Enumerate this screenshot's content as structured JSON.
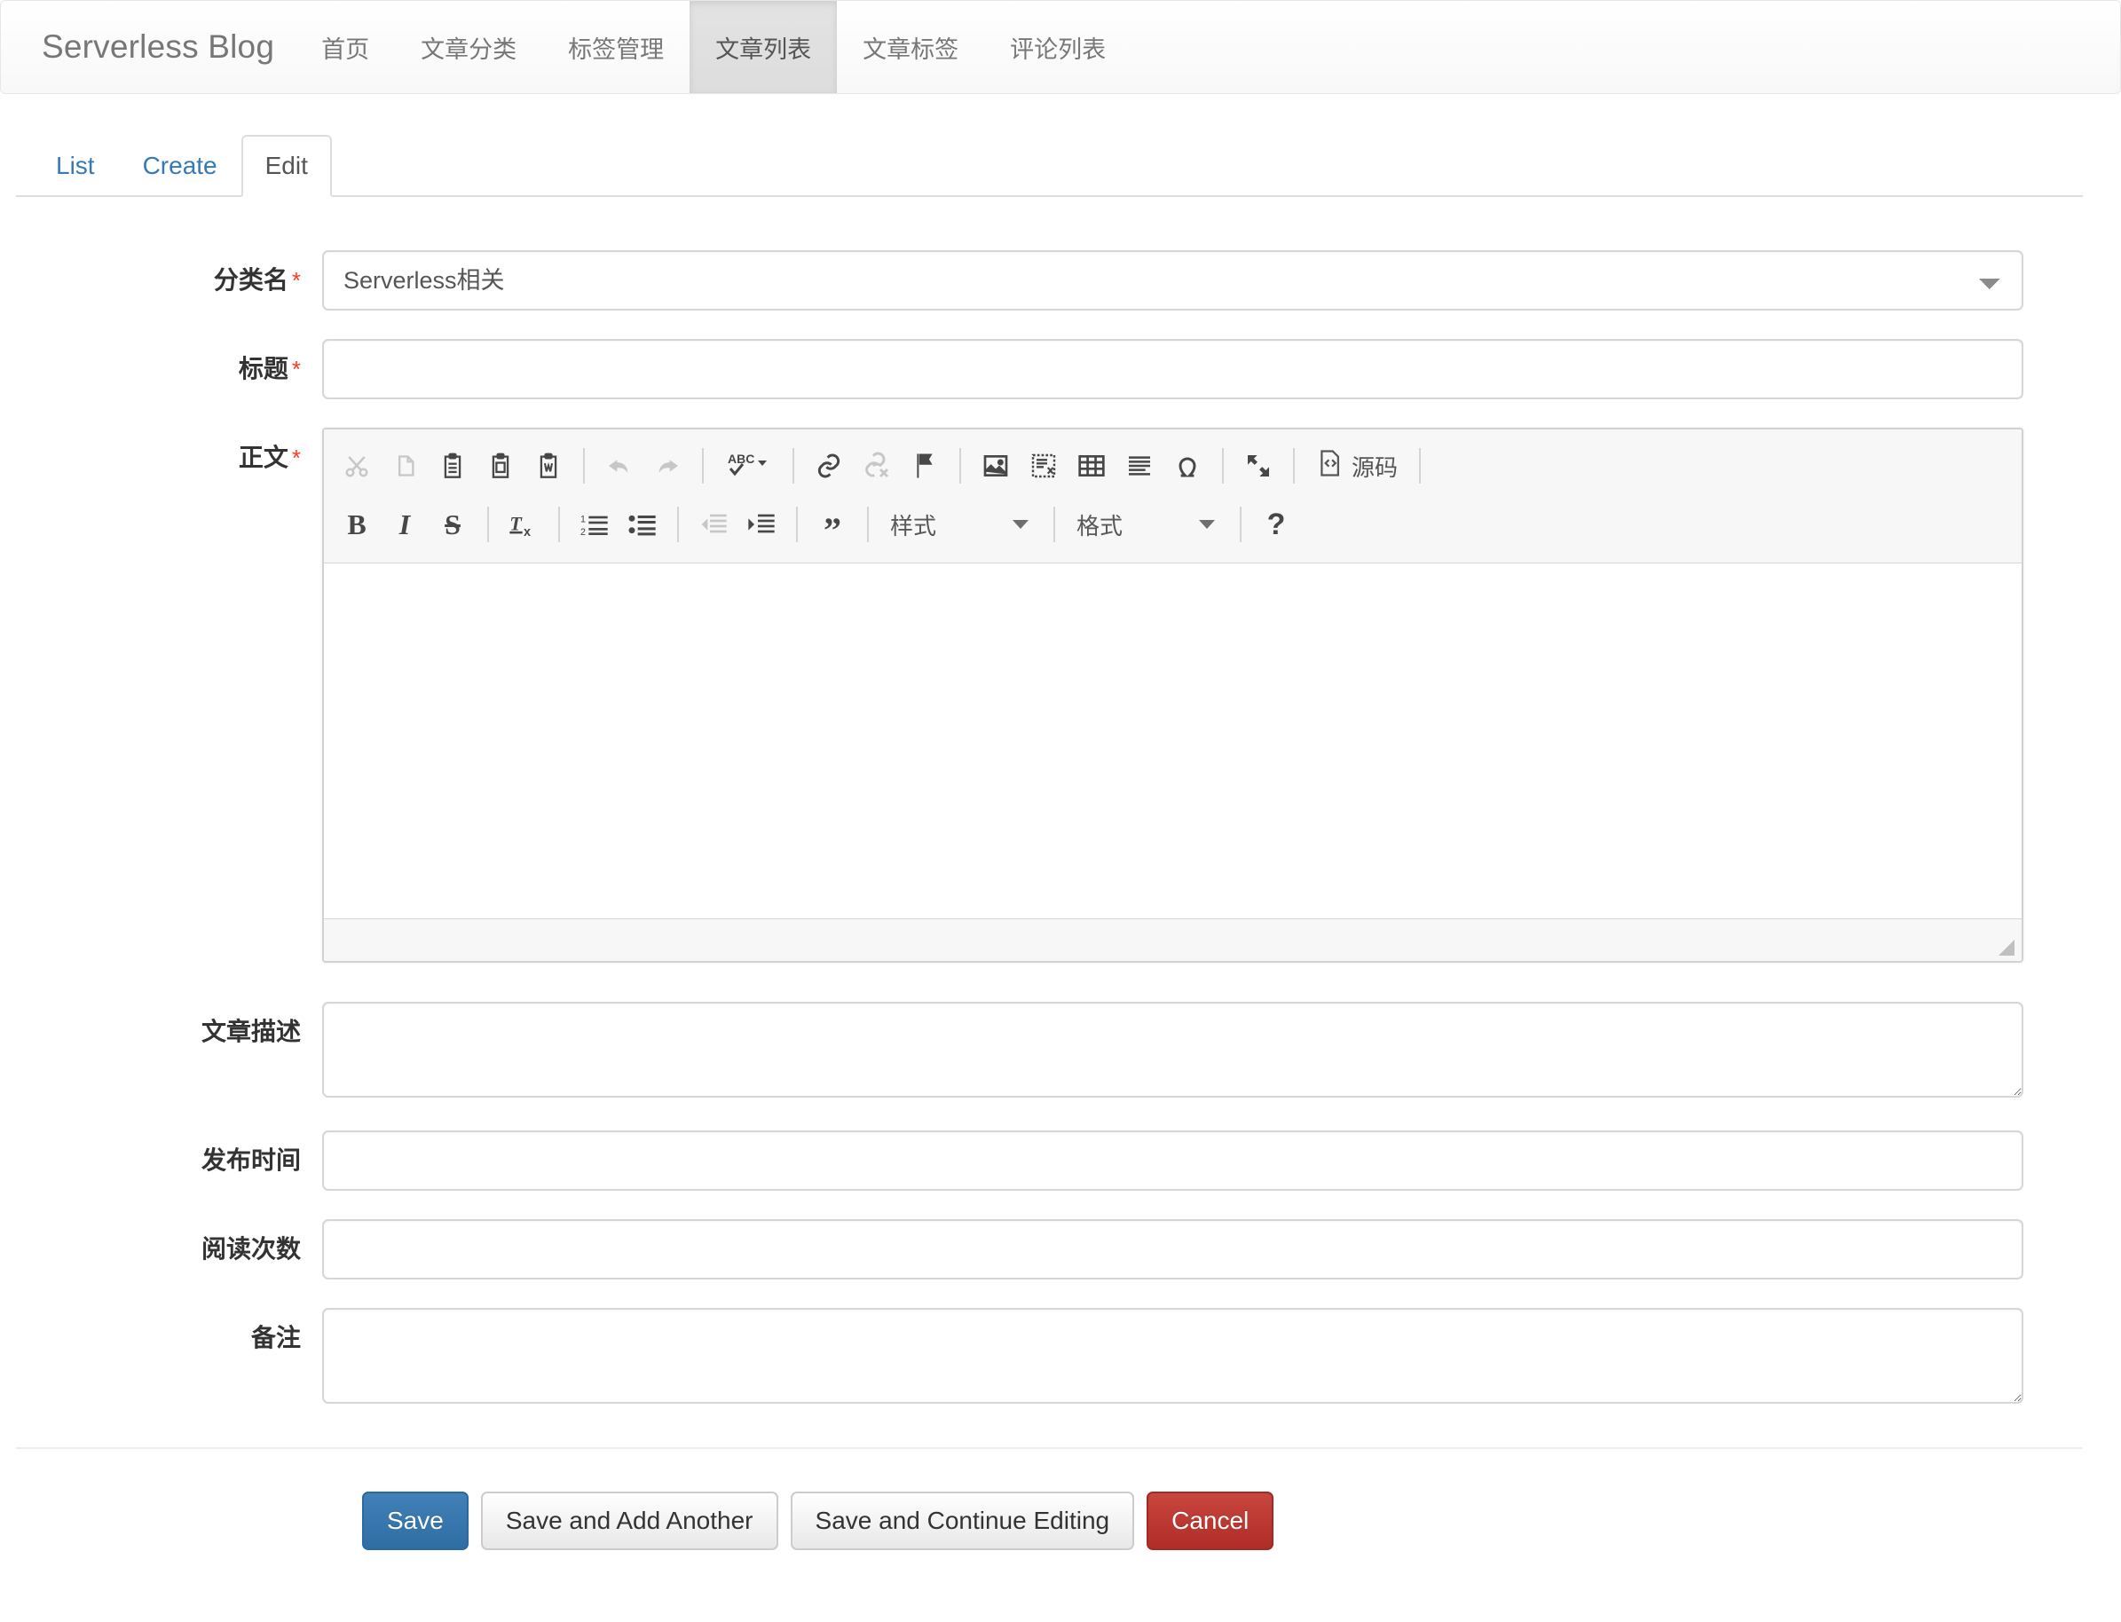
{
  "navbar": {
    "brand": "Serverless Blog",
    "items": [
      {
        "label": "首页",
        "active": false
      },
      {
        "label": "文章分类",
        "active": false
      },
      {
        "label": "标签管理",
        "active": false
      },
      {
        "label": "文章列表",
        "active": true
      },
      {
        "label": "文章标签",
        "active": false
      },
      {
        "label": "评论列表",
        "active": false
      }
    ]
  },
  "tabs": [
    {
      "label": "List",
      "active": false
    },
    {
      "label": "Create",
      "active": false
    },
    {
      "label": "Edit",
      "active": true
    }
  ],
  "form": {
    "category": {
      "label": "分类名",
      "required": "*",
      "value": "Serverless相关",
      "options": [
        "Serverless相关"
      ]
    },
    "title": {
      "label": "标题",
      "required": "*",
      "value": "",
      "placeholder": ""
    },
    "content": {
      "label": "正文",
      "required": "*",
      "value": ""
    },
    "description": {
      "label": "文章描述",
      "value": "",
      "placeholder": ""
    },
    "publish_time": {
      "label": "发布时间",
      "value": "",
      "placeholder": ""
    },
    "read_count": {
      "label": "阅读次数",
      "value": "",
      "placeholder": ""
    },
    "remark": {
      "label": "备注",
      "value": "",
      "placeholder": ""
    }
  },
  "editor": {
    "toolbar_row1": [
      {
        "icon": "cut-icon",
        "name": "cut",
        "disabled": true
      },
      {
        "icon": "copy-icon",
        "name": "copy",
        "disabled": true
      },
      {
        "icon": "paste-icon",
        "name": "paste",
        "disabled": false
      },
      {
        "icon": "paste-text-icon",
        "name": "paste-as-plain-text",
        "disabled": false
      },
      {
        "icon": "paste-word-icon",
        "name": "paste-from-word",
        "disabled": false
      },
      {
        "icon": "separator",
        "name": "separator",
        "disabled": false
      },
      {
        "icon": "undo-icon",
        "name": "undo",
        "disabled": true
      },
      {
        "icon": "redo-icon",
        "name": "redo",
        "disabled": true
      },
      {
        "icon": "separator",
        "name": "separator",
        "disabled": false
      },
      {
        "icon": "spellcheck-icon",
        "name": "spell-check-as-you-type",
        "disabled": false
      },
      {
        "icon": "separator",
        "name": "separator",
        "disabled": false
      },
      {
        "icon": "link-icon",
        "name": "link",
        "disabled": false
      },
      {
        "icon": "unlink-icon",
        "name": "unlink",
        "disabled": true
      },
      {
        "icon": "anchor-flag-icon",
        "name": "anchor",
        "disabled": false
      },
      {
        "icon": "separator",
        "name": "separator",
        "disabled": false
      },
      {
        "icon": "image-icon",
        "name": "image",
        "disabled": false
      },
      {
        "icon": "iframe-icon",
        "name": "iframe",
        "disabled": false
      },
      {
        "icon": "table-icon",
        "name": "table",
        "disabled": false
      },
      {
        "icon": "horizontal-rule-icon",
        "name": "horizontal-rule",
        "disabled": false
      },
      {
        "icon": "omega-icon",
        "name": "special-character",
        "disabled": false
      },
      {
        "icon": "separator",
        "name": "separator",
        "disabled": false
      },
      {
        "icon": "maximize-icon",
        "name": "maximize",
        "disabled": false
      },
      {
        "icon": "separator",
        "name": "separator",
        "disabled": false
      }
    ],
    "source_button": {
      "icon": "source-code-icon",
      "label": "源码"
    },
    "toolbar_row2": [
      {
        "icon": "bold-icon",
        "name": "bold",
        "glyph": "B",
        "disabled": false
      },
      {
        "icon": "italic-icon",
        "name": "italic",
        "glyph": "I",
        "disabled": false
      },
      {
        "icon": "strikethrough-icon",
        "name": "strike-through",
        "glyph": "S",
        "disabled": false
      },
      {
        "icon": "separator",
        "name": "separator",
        "disabled": false
      },
      {
        "icon": "remove-format-icon",
        "name": "remove-format",
        "disabled": false
      },
      {
        "icon": "separator",
        "name": "separator",
        "disabled": false
      },
      {
        "icon": "numbered-list-icon",
        "name": "insert-remove-numbered-list",
        "disabled": false
      },
      {
        "icon": "bulleted-list-icon",
        "name": "insert-remove-bulleted-list",
        "disabled": false
      },
      {
        "icon": "separator",
        "name": "separator",
        "disabled": false
      },
      {
        "icon": "outdent-icon",
        "name": "decrease-indent",
        "disabled": true
      },
      {
        "icon": "indent-icon",
        "name": "increase-indent",
        "disabled": false
      },
      {
        "icon": "separator",
        "name": "separator",
        "disabled": false
      },
      {
        "icon": "blockquote-icon",
        "name": "block-quote",
        "disabled": false
      },
      {
        "icon": "separator",
        "name": "separator",
        "disabled": false
      }
    ],
    "styles_combo": "样式",
    "format_combo": "格式",
    "help_button": "?"
  },
  "buttons": [
    {
      "label": "Save",
      "variant": "primary",
      "name": "save-button"
    },
    {
      "label": "Save and Add Another",
      "variant": "default",
      "name": "save-and-add-another-button"
    },
    {
      "label": "Save and Continue Editing",
      "variant": "default",
      "name": "save-and-continue-editing-button"
    },
    {
      "label": "Cancel",
      "variant": "danger",
      "name": "cancel-button"
    }
  ],
  "colors": {
    "link": "#337ab7",
    "required_star": "#ff3a21",
    "primary_button": "#3276b1",
    "danger_button": "#bd362f",
    "navbar_bg": "#f8f8f8",
    "active_nav_bg": "#e0e0e0"
  }
}
